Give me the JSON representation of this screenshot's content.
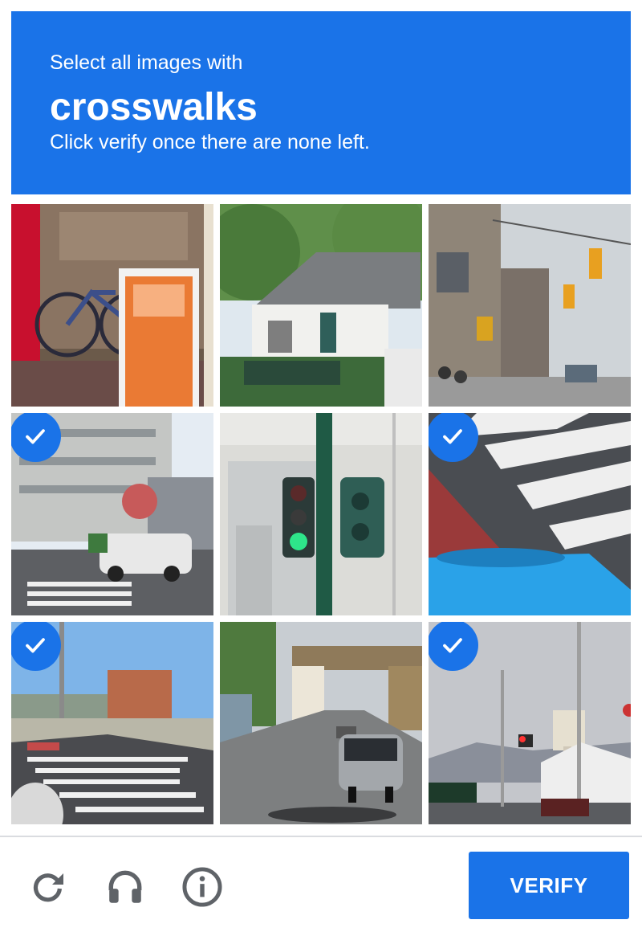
{
  "header": {
    "instruction": "Select all images with",
    "keyword": "crosswalks",
    "subtext": "Click verify once there are none left."
  },
  "tiles": [
    {
      "scene": "bicycles-and-sign",
      "selected": false
    },
    {
      "scene": "white-house",
      "selected": false
    },
    {
      "scene": "street-with-traffic-light",
      "selected": false
    },
    {
      "scene": "building-with-crosswalk",
      "selected": true
    },
    {
      "scene": "pedestrian-signal",
      "selected": false
    },
    {
      "scene": "crosswalk-closeup",
      "selected": true
    },
    {
      "scene": "intersection-crosswalk",
      "selected": true
    },
    {
      "scene": "car-under-bridge",
      "selected": false
    },
    {
      "scene": "street-with-water-tower",
      "selected": true
    }
  ],
  "footer": {
    "icons": [
      "reload-icon",
      "audio-icon",
      "info-icon"
    ],
    "verify_label": "VERIFY"
  },
  "colors": {
    "accent": "#1a73e8",
    "divider": "#dadce0",
    "footer_icon": "#5f6368"
  }
}
